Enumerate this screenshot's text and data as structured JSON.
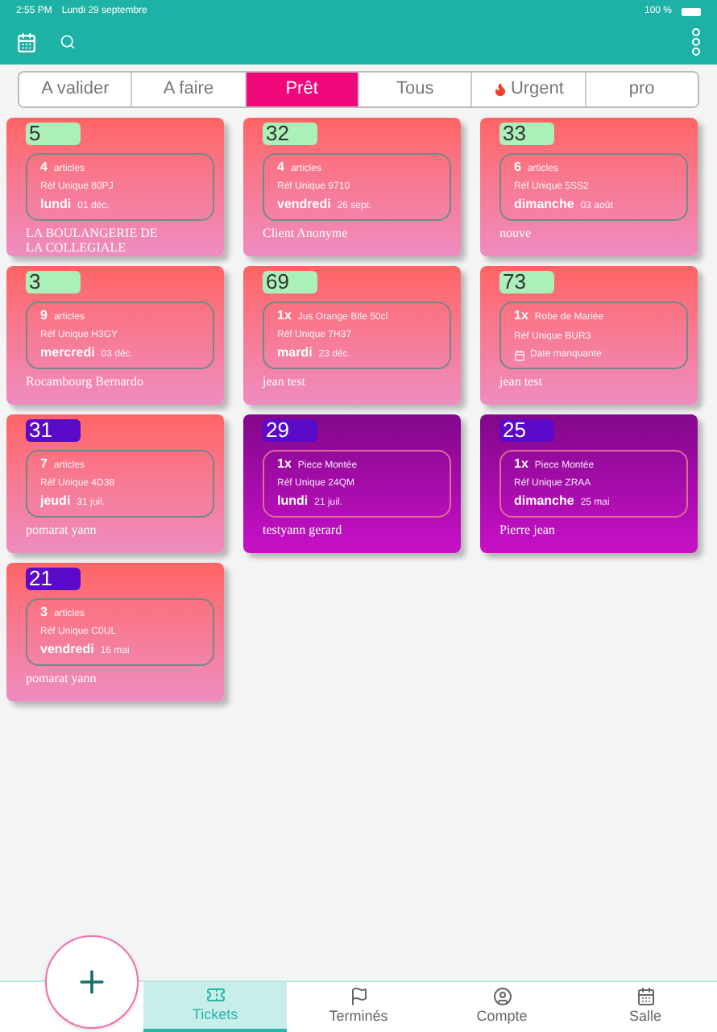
{
  "status_bar": {
    "time": "2:55 PM",
    "date": "Lundi 29 septembre",
    "battery": "100 %"
  },
  "tabs": [
    {
      "label": "A valider",
      "selected": false
    },
    {
      "label": "A faire",
      "selected": false
    },
    {
      "label": "Prêt",
      "selected": true
    },
    {
      "label": "Tous",
      "selected": false
    },
    {
      "label": "Urgent",
      "selected": false,
      "flame": true
    },
    {
      "label": "pro",
      "selected": false
    }
  ],
  "tickets": [
    {
      "number": "5",
      "color": "#aaf0b8",
      "kind": "salmon",
      "qty": "4",
      "item": "articles",
      "ref": "Réf Unique 80PJ",
      "when": {
        "kind": "date",
        "day": "lundi",
        "date": "01 déc."
      },
      "client": "LA BOULANGERIE DE LA COLLEGIALE"
    },
    {
      "number": "32",
      "color": "#aaf0b8",
      "kind": "salmon",
      "qty": "4",
      "item": "articles",
      "ref": "Réf Unique 9710",
      "when": {
        "kind": "date",
        "day": "vendredi",
        "date": "26 sept."
      },
      "client": "Client Anonyme"
    },
    {
      "number": "33",
      "color": "#aaf0b8",
      "kind": "salmon",
      "qty": "6",
      "item": "articles",
      "ref": "Réf Unique 5SS2",
      "when": {
        "kind": "date",
        "day": "dimanche",
        "date": "03 août"
      },
      "client": "nouve"
    },
    {
      "number": "3",
      "color": "#aaf0b8",
      "kind": "salmon",
      "qty": "9",
      "item": "articles",
      "ref": "Réf Unique H3GY",
      "when": {
        "kind": "date",
        "day": "mercredi",
        "date": "03 déc."
      },
      "client": "Rocambourg Bernardo"
    },
    {
      "number": "69",
      "color": "#aaf0b8",
      "kind": "salmon",
      "qty": "1x",
      "item": "Jus Orange Btle 50cl",
      "ref": "Réf Unique 7H37",
      "when": {
        "kind": "date",
        "day": "mardi",
        "date": "23 déc."
      },
      "client": "jean test"
    },
    {
      "number": "73",
      "color": "#aaf0b8",
      "kind": "salmon",
      "qty": "1x",
      "item": "Robe de Mariée",
      "ref": "Réf Unique BUR3",
      "when": {
        "kind": "missing",
        "text": "Date manquante"
      },
      "client": "jean test"
    },
    {
      "number": "31",
      "color": "#5a0ac8",
      "kind": "salmon",
      "qty": "7",
      "item": "articles",
      "ref": "Réf Unique 4D38",
      "when": {
        "kind": "date",
        "day": "jeudi",
        "date": "31 juil."
      },
      "client": "pomarat yann"
    },
    {
      "number": "29",
      "color": "#5a0ac8",
      "kind": "purple",
      "qty": "1x",
      "item": "Piece Montée",
      "ref": "Réf Unique 24QM",
      "when": {
        "kind": "date",
        "day": "lundi",
        "date": "21 juil."
      },
      "client": "testyann gerard"
    },
    {
      "number": "25",
      "color": "#5a0ac8",
      "kind": "purple",
      "qty": "1x",
      "item": "Piece Montée",
      "ref": "Réf Unique ZRAA",
      "when": {
        "kind": "date",
        "day": "dimanche",
        "date": "25 mai"
      },
      "client": "Pierre jean"
    },
    {
      "number": "21",
      "color": "#5a0ac8",
      "kind": "salmon",
      "qty": "3",
      "item": "articles",
      "ref": "Réf Unique C0UL",
      "when": {
        "kind": "date",
        "day": "vendredi",
        "date": "16 mai"
      },
      "client": "pomarat yann"
    }
  ],
  "bottom_tabs": [
    {
      "label": "Tickets",
      "selected": true
    },
    {
      "label": "Terminés",
      "selected": false
    },
    {
      "label": "Compte",
      "selected": false
    },
    {
      "label": "Salle",
      "selected": false
    }
  ]
}
